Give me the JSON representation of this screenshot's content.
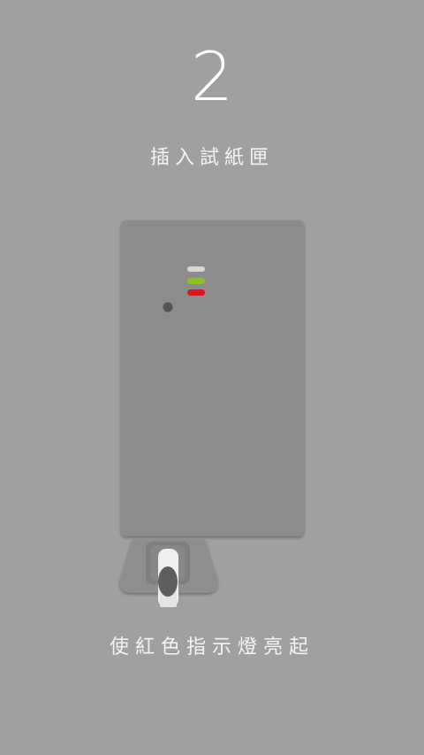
{
  "step": {
    "number": "2",
    "title": "插入試紙匣"
  },
  "instruction": {
    "text": "使紅色指示燈亮起"
  },
  "device": {
    "indicator_lights": [
      {
        "name": "white-light",
        "color": "#d6d6d6"
      },
      {
        "name": "green-light",
        "color": "#8cc21a"
      },
      {
        "name": "red-light",
        "color": "#e0141c"
      }
    ]
  },
  "colors": {
    "background": "#a0a0a0",
    "device_body": "#8c8c8c",
    "text": "#ffffff"
  }
}
